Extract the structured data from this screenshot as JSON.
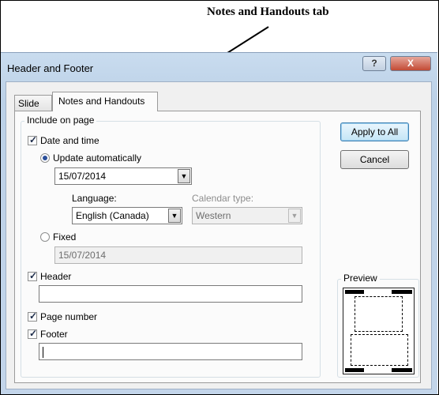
{
  "annotation": {
    "text": "Notes and Handouts tab"
  },
  "window": {
    "title": "Header and Footer",
    "help_label": "?",
    "close_label": "X"
  },
  "tabs": [
    {
      "label": "Slide",
      "selected": false
    },
    {
      "label": "Notes and Handouts",
      "selected": true
    }
  ],
  "include": {
    "legend": "Include on page",
    "date_time": {
      "label": "Date and time",
      "checked": true
    },
    "update_auto": {
      "label": "Update automatically",
      "selected": true
    },
    "date_value": "15/07/2014",
    "language_label": "Language:",
    "language_value": "English (Canada)",
    "calendar_label": "Calendar type:",
    "calendar_value": "Western",
    "fixed": {
      "label": "Fixed",
      "selected": false
    },
    "fixed_value": "15/07/2014",
    "header": {
      "label": "Header",
      "checked": true,
      "value": ""
    },
    "page_number": {
      "label": "Page number",
      "checked": true
    },
    "footer": {
      "label": "Footer",
      "checked": true,
      "value": ""
    }
  },
  "buttons": {
    "apply_all": "Apply to All",
    "cancel": "Cancel"
  },
  "preview": {
    "label": "Preview"
  },
  "icons": {
    "dropdown": "▼",
    "check": "✓"
  }
}
